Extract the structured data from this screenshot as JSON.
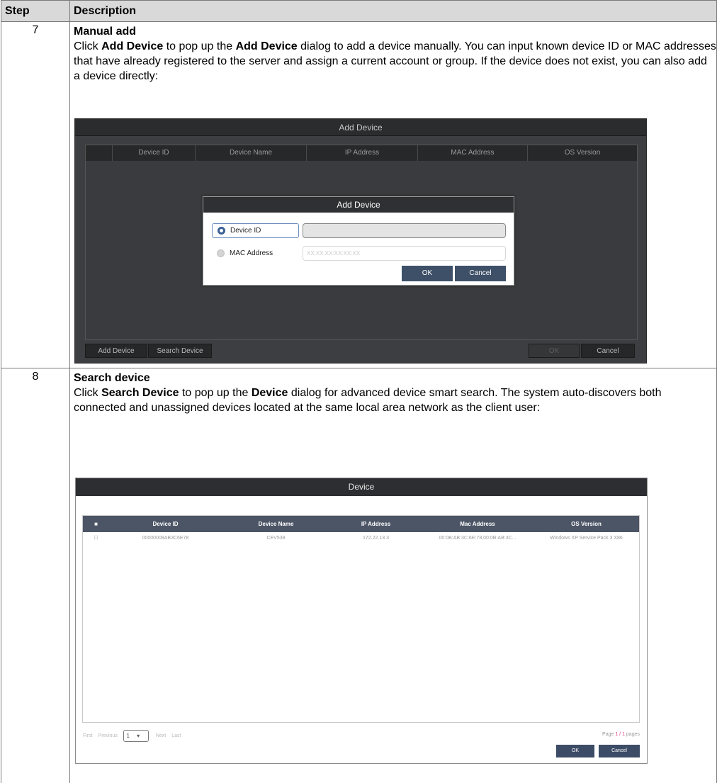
{
  "table": {
    "headers": [
      "Step",
      "Description"
    ],
    "rows": [
      {
        "step": "7",
        "title": "Manual add",
        "text_parts": [
          "Click ",
          "Add Device",
          " to pop up the ",
          "Add Device",
          " dialog to add a device manually. You can input known device ID or MAC addresses that have already registered to the server and assign a current account or group. If the device does not exist, you can also add a device directly:"
        ]
      },
      {
        "step": "8",
        "title": "Search device",
        "text_parts": [
          "Click ",
          "Search Device",
          " to pop up the ",
          "Device",
          " dialog for advanced device smart search. The system auto-discovers both connected and unassigned devices located at the same local area network as the client user:"
        ]
      }
    ]
  },
  "add_device_window": {
    "title": "Add Device",
    "columns": [
      "Device ID",
      "Device Name",
      "IP Address",
      "MAC Address",
      "OS Version"
    ],
    "buttons": {
      "add_device": "Add Device",
      "search_device": "Search Device",
      "ok": "OK",
      "cancel": "Cancel"
    },
    "dialog": {
      "title": "Add Device",
      "device_id_label": "Device ID",
      "mac_address_label": "MAC Address",
      "mac_placeholder": "XX:XX:XX:XX:XX:XX",
      "ok": "OK",
      "cancel": "Cancel"
    }
  },
  "device_window": {
    "title": "Device",
    "columns": [
      "Device ID",
      "Device Name",
      "IP Address",
      "Mac Address",
      "OS Version"
    ],
    "rows": [
      {
        "device_id": "00000008AB3C6E78",
        "device_name": "CEV538",
        "ip": "172.22.13.3",
        "mac": "00:0B:AB:3C:6E:78,00:0B:AB:3C...",
        "os": "Windows XP Service Pack 3 X86"
      }
    ],
    "pager": {
      "first": "First",
      "previous": "Previous",
      "page": "1",
      "next": "Next",
      "last": "Last",
      "page_info_prefix": "Page ",
      "page_info_value": "1 / 1",
      "page_info_suffix": " pages"
    },
    "buttons": {
      "ok": "OK",
      "cancel": "Cancel"
    }
  }
}
